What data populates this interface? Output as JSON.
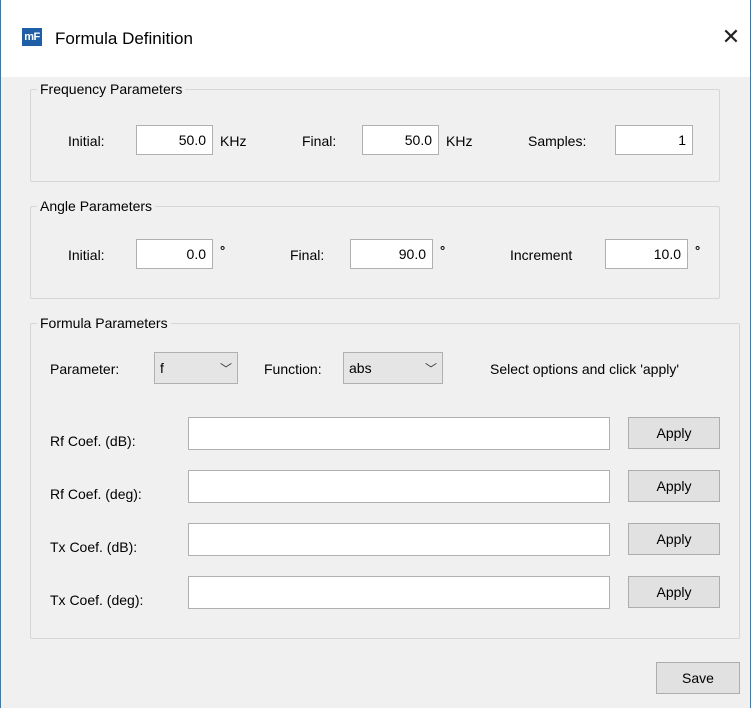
{
  "window": {
    "title": "Formula Definition",
    "icon_text": "mF",
    "close_glyph": "✕",
    "border_color": "#1883d7"
  },
  "frequency": {
    "legend": "Frequency Parameters",
    "initial_label": "Initial:",
    "initial_value": "50.0",
    "initial_unit": "KHz",
    "final_label": "Final:",
    "final_value": "50.0",
    "final_unit": "KHz",
    "samples_label": "Samples:",
    "samples_value": "1"
  },
  "angle": {
    "legend": "Angle Parameters",
    "initial_label": "Initial:",
    "initial_value": "0.0",
    "final_label": "Final:",
    "final_value": "90.0",
    "increment_label": "Increment",
    "increment_value": "10.0",
    "unit": "°"
  },
  "formula": {
    "legend": "Formula Parameters",
    "parameter_label": "Parameter:",
    "parameter_value": "f",
    "function_label": "Function:",
    "function_value": "abs",
    "hint": "Select options and click 'apply'",
    "chevron": "﹀",
    "rows": [
      {
        "label": "Rf Coef. (dB):",
        "value": "",
        "button": "Apply"
      },
      {
        "label": "Rf Coef. (deg):",
        "value": "",
        "button": "Apply"
      },
      {
        "label": "Tx Coef. (dB):",
        "value": "",
        "button": "Apply"
      },
      {
        "label": "Tx Coef. (deg):",
        "value": "",
        "button": "Apply"
      }
    ]
  },
  "footer": {
    "save_label": "Save"
  }
}
